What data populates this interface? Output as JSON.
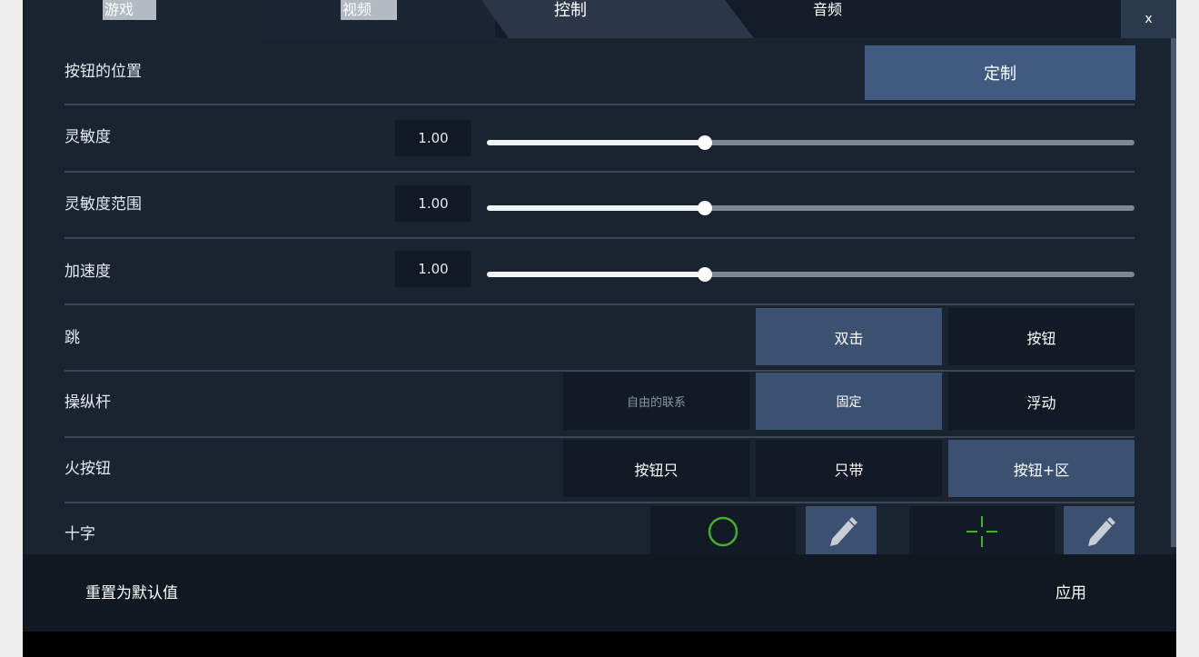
{
  "tabs": [
    {
      "label": "游戏"
    },
    {
      "label": "视频"
    },
    {
      "label": "控制"
    },
    {
      "label": "音频"
    }
  ],
  "active_tab": "控制",
  "close_label": "x",
  "settings": {
    "button_position": {
      "label": "按钮的位置",
      "customize_label": "定制"
    },
    "sensitivity": {
      "label": "灵敏度",
      "value": "1.00",
      "level": 0.336
    },
    "sensitivity_range": {
      "label": "灵敏度范围",
      "value": "1.00",
      "level": 0.336
    },
    "acceleration": {
      "label": "加速度",
      "value": "1.00",
      "level": 0.336
    },
    "jump": {
      "label": "跳",
      "options": [
        "双击",
        "按钮"
      ],
      "selected": "双击"
    },
    "joystick": {
      "label": "操纵杆",
      "options": [
        "自由的联系",
        "固定",
        "浮动"
      ],
      "selected": "固定"
    },
    "fire_button": {
      "label": "火按钮",
      "options": [
        "按钮只",
        "只带",
        "按钮+区"
      ],
      "selected": "按钮+区"
    },
    "crosshair": {
      "label": "十字"
    }
  },
  "footer": {
    "reset_label": "重置为默认值",
    "apply_label": "应用"
  },
  "colors": {
    "panel_bg": "#1a2330",
    "selected_option": "#3c5170",
    "accent_button": "#405a80",
    "crosshair_green": "#43b02a"
  },
  "icons": [
    "close-icon",
    "circle-crosshair-icon",
    "pencil-icon",
    "cross-crosshair-icon"
  ]
}
